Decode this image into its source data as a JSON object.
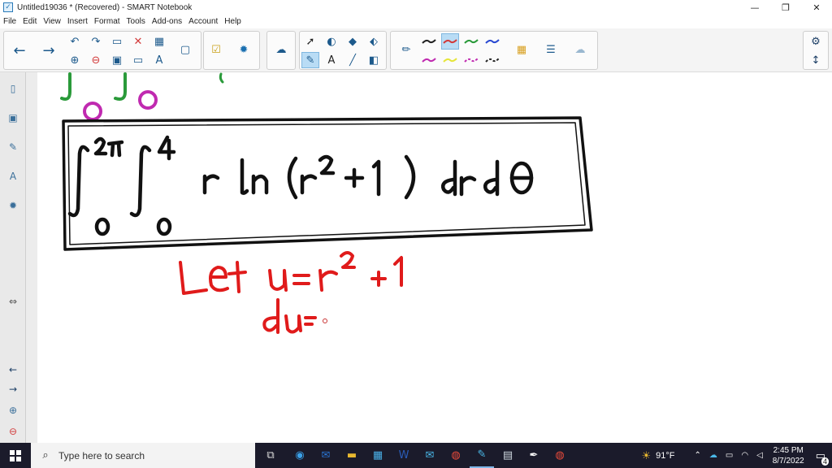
{
  "window": {
    "title": "Untitled19036 * (Recovered) - SMART Notebook",
    "controls": [
      "—",
      "❐",
      "✕"
    ]
  },
  "menu": [
    "File",
    "Edit",
    "View",
    "Insert",
    "Format",
    "Tools",
    "Add-ons",
    "Account",
    "Help"
  ],
  "toolbar": {
    "pen_colors": [
      "#222222",
      "#d23a3a",
      "#2a9a3a",
      "#2a4ad2",
      "#c02ab0",
      "#e6e63a",
      "#c02ab0",
      "#222222"
    ]
  },
  "board": {
    "let_line": "Let u = r² + 1",
    "du_line": "du ="
  },
  "taskbar": {
    "search_placeholder": "Type here to search",
    "weather": "91°F",
    "time": "2:45 PM",
    "date": "8/7/2022",
    "notifications": "4"
  }
}
